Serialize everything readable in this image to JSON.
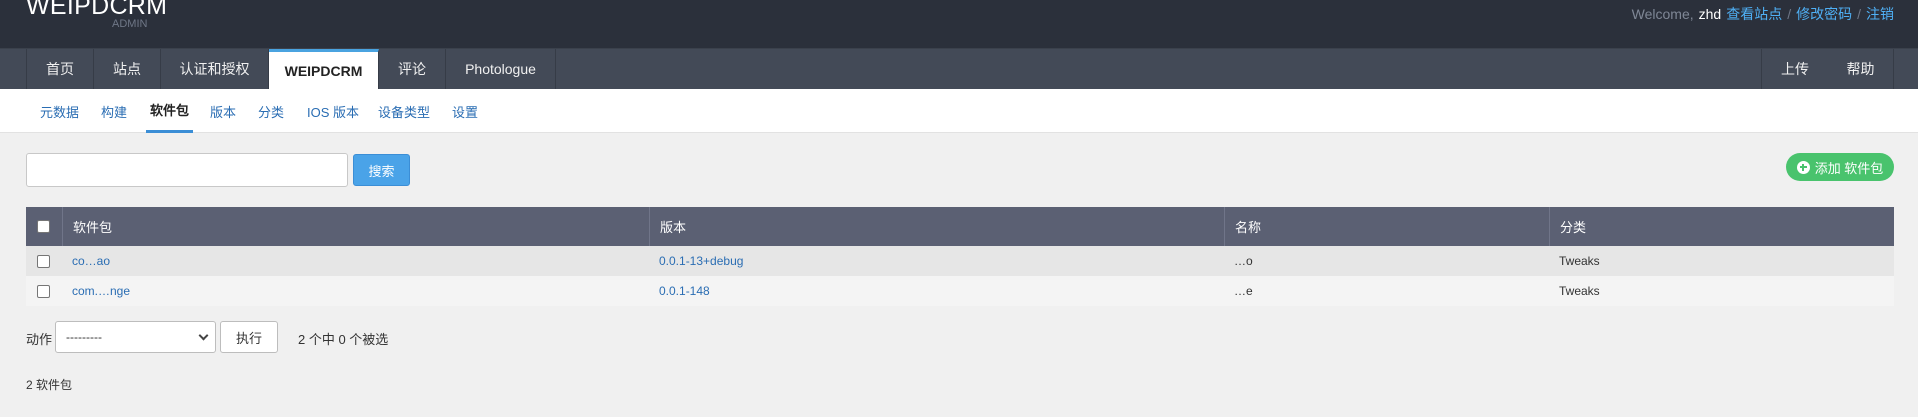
{
  "header": {
    "brand": "WEIPDCRM",
    "brand_sub": "ADMIN",
    "welcome": "Welcome,",
    "username": "zhd",
    "links": [
      "查看站点",
      "修改密码",
      "注销"
    ]
  },
  "main_nav": {
    "items": [
      "首页",
      "站点",
      "认证和授权",
      "WEIPDCRM",
      "评论",
      "Photologue"
    ],
    "active": "WEIPDCRM",
    "right_items": [
      "上传",
      "帮助"
    ]
  },
  "sub_nav": {
    "items": [
      "元数据",
      "构建",
      "软件包",
      "版本",
      "分类",
      "IOS 版本",
      "设备类型",
      "设置"
    ],
    "active": "软件包"
  },
  "search": {
    "value": "",
    "button_label": "搜索"
  },
  "add_button": {
    "label": "添加 软件包",
    "color": "#49c36d"
  },
  "table": {
    "columns": [
      "软件包",
      "版本",
      "名称",
      "分类"
    ],
    "rows": [
      {
        "package": "co…ao",
        "version": "0.0.1-13+debug",
        "name": "…o",
        "category": "Tweaks"
      },
      {
        "package": "com.…nge",
        "version": "0.0.1-148",
        "name": "…e",
        "category": "Tweaks"
      }
    ]
  },
  "actions": {
    "label": "动作",
    "select_value": "---------",
    "go_label": "执行",
    "selection_count": "2 个中 0 个被选"
  },
  "footer": {
    "total": "2 软件包"
  },
  "colors": {
    "header_bg": "#2b303b",
    "nav_bg": "#434a57",
    "accent": "#4aa3e8",
    "table_header": "#5b6073"
  }
}
